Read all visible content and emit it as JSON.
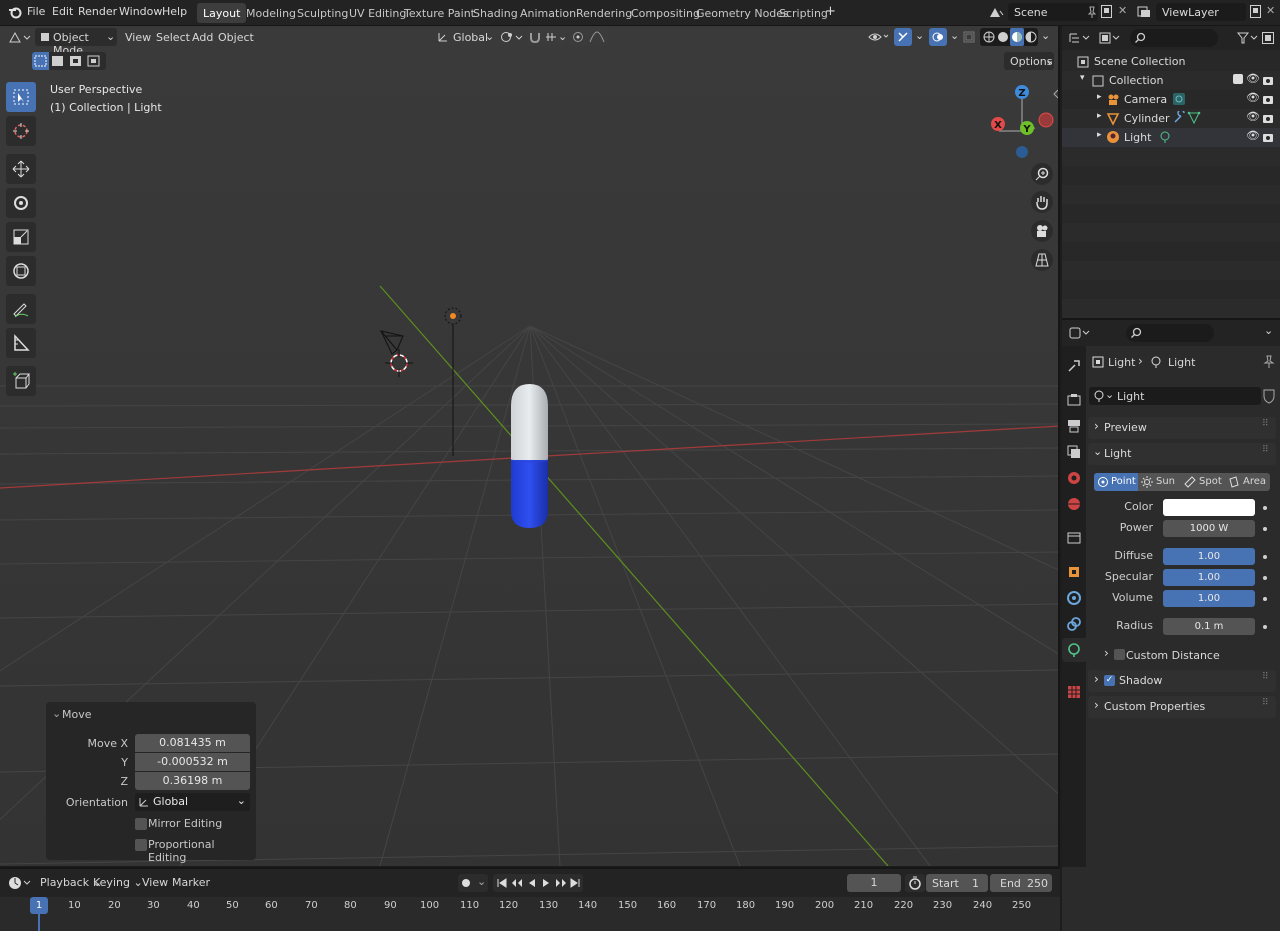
{
  "topbar": {
    "menus": [
      "File",
      "Edit",
      "Render",
      "Window",
      "Help"
    ],
    "workspaces": [
      "Layout",
      "Modeling",
      "Sculpting",
      "UV Editing",
      "Texture Paint",
      "Shading",
      "Animation",
      "Rendering",
      "Compositing",
      "Geometry Nodes",
      "Scripting"
    ],
    "active_workspace": "Layout",
    "add_tab": "+",
    "scene": "Scene",
    "view_layer": "ViewLayer"
  },
  "viewport": {
    "mode": "Object Mode",
    "menus": [
      "View",
      "Select",
      "Add",
      "Object"
    ],
    "orientation": "Global",
    "options": "Options",
    "info_line1": "User Perspective",
    "info_line2": "(1) Collection | Light",
    "gizmo": {
      "x": "X",
      "y": "Y",
      "z": "Z"
    }
  },
  "move_panel": {
    "title": "Move",
    "move_x_label": "Move X",
    "move_x": "0.081435 m",
    "y_label": "Y",
    "y": "-0.000532 m",
    "z_label": "Z",
    "z": "0.36198 m",
    "orientation_label": "Orientation",
    "orientation": "Global",
    "mirror": "Mirror Editing",
    "proportional": "Proportional Editing"
  },
  "outliner": {
    "scene_collection": "Scene Collection",
    "collection": "Collection",
    "items": [
      "Camera",
      "Cylinder",
      "Light"
    ]
  },
  "properties": {
    "breadcrumb_obj": "Light",
    "breadcrumb_data": "Light",
    "data_name": "Light",
    "preview": "Preview",
    "light_panel": "Light",
    "types": [
      "Point",
      "Sun",
      "Spot",
      "Area"
    ],
    "active_type": "Point",
    "color_label": "Color",
    "color_value": "#ffffff",
    "power_label": "Power",
    "power": "1000 W",
    "diffuse_label": "Diffuse",
    "diffuse": "1.00",
    "specular_label": "Specular",
    "specular": "1.00",
    "volume_label": "Volume",
    "volume": "1.00",
    "radius_label": "Radius",
    "radius": "0.1 m",
    "custom_distance": "Custom Distance",
    "shadow": "Shadow",
    "custom_properties": "Custom Properties"
  },
  "timeline": {
    "menus": [
      "Playback",
      "Keying",
      "View",
      "Marker"
    ],
    "current_frame": "1",
    "start_label": "Start",
    "start": "1",
    "end_label": "End",
    "end": "250",
    "ticks": [
      "10",
      "20",
      "30",
      "40",
      "50",
      "60",
      "70",
      "80",
      "90",
      "100",
      "110",
      "120",
      "130",
      "140",
      "150",
      "160",
      "170",
      "180",
      "190",
      "200",
      "210",
      "220",
      "230",
      "240",
      "250"
    ],
    "cursor_frame": "1"
  },
  "colors": {
    "accent": "#4772b3",
    "x_axis": "#e04a4a",
    "y_axis": "#6fbf2a",
    "z_axis": "#3d8bdc"
  }
}
